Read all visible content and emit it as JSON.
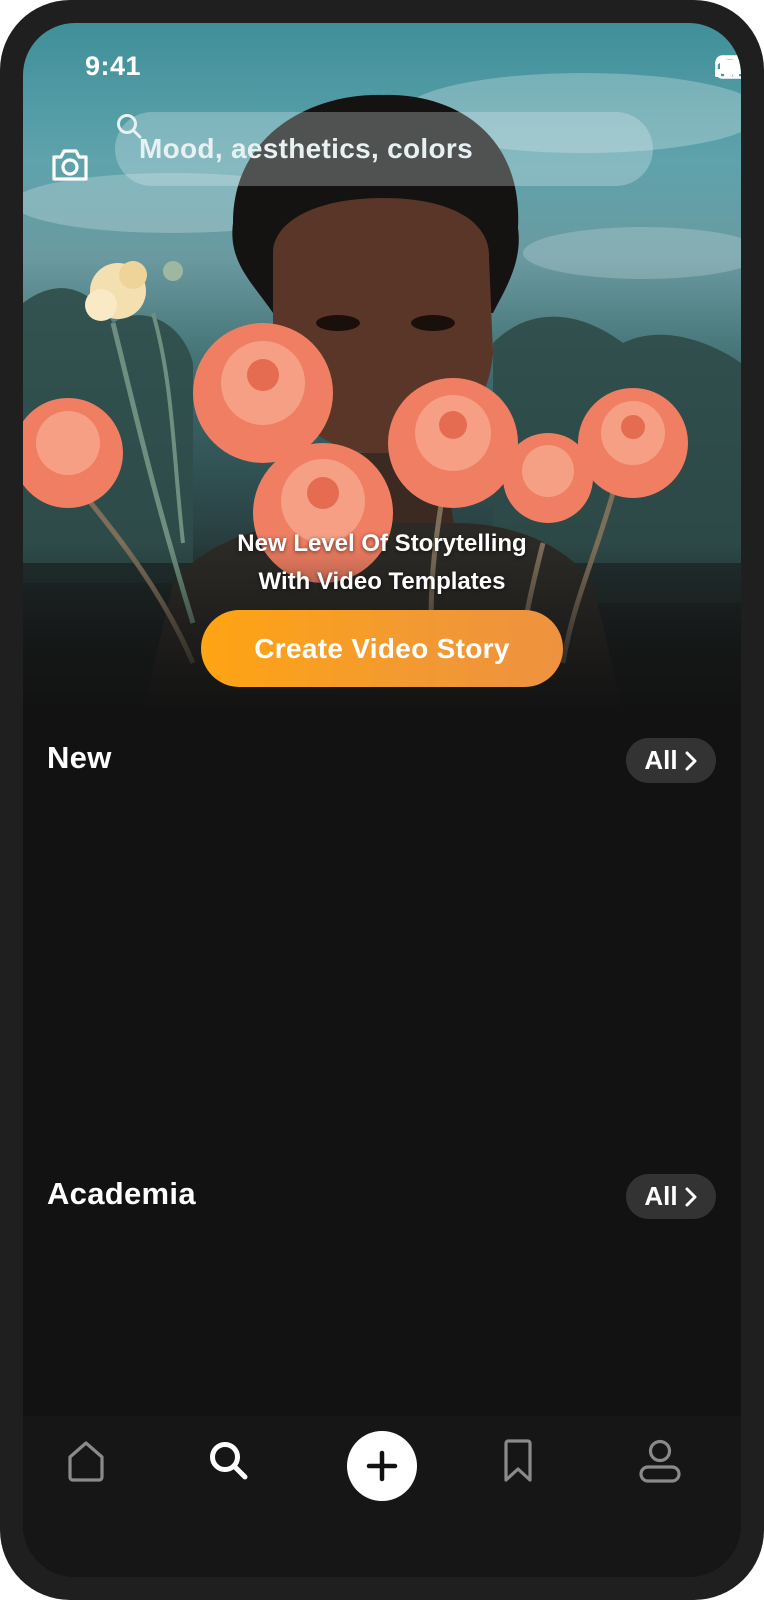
{
  "status_bar": {
    "time": "9:41"
  },
  "search": {
    "placeholder": "Mood, aesthetics, colors"
  },
  "hero": {
    "headline_line1": "New Level Of Storytelling",
    "headline_line2": "With Video Templates",
    "cta_label": "Create Video Story"
  },
  "sections": [
    {
      "title": "New",
      "all_label": "All"
    },
    {
      "title": "Academia",
      "all_label": "All"
    }
  ],
  "bottom_nav": {
    "items": [
      {
        "icon": "home-icon",
        "active": false
      },
      {
        "icon": "search-icon",
        "active": true
      },
      {
        "icon": "plus-icon",
        "active": false
      },
      {
        "icon": "bookmark-icon",
        "active": false
      },
      {
        "icon": "profile-icon",
        "active": false
      }
    ]
  },
  "colors": {
    "background": "#121212",
    "accent_start": "#FFA412",
    "accent_end": "#EE9240",
    "pill_bg": "#333333",
    "text": "#FFFFFF"
  }
}
